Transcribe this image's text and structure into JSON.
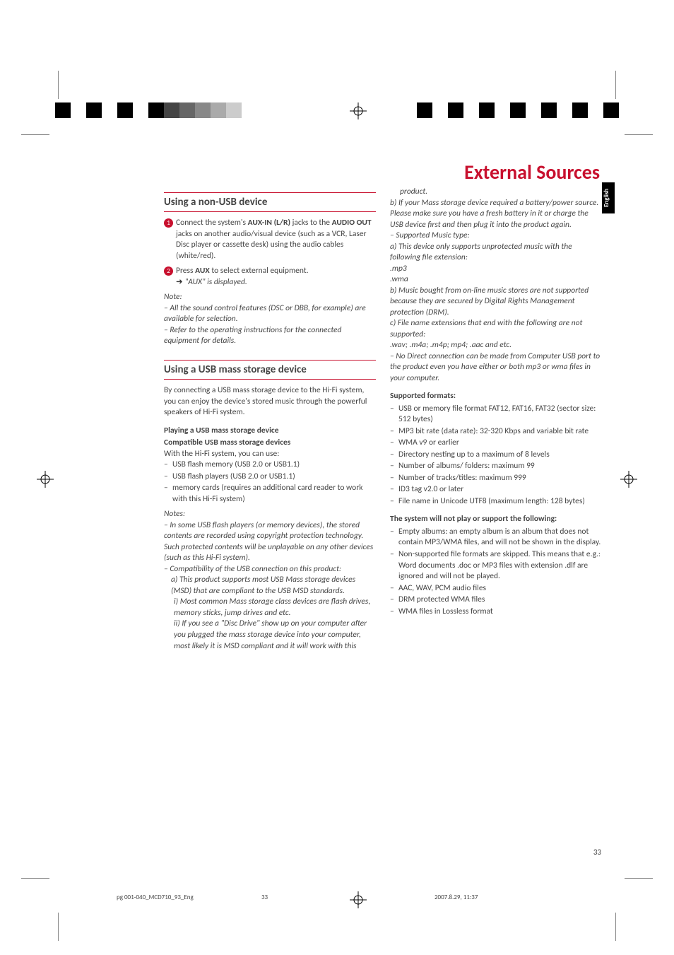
{
  "pageTitle": "External Sources",
  "langTab": "English",
  "pageNumber": "33",
  "footer": {
    "left": "pg 001-040_MCD710_93_Eng",
    "mid": "33",
    "right": "2007.8.29, 11:37"
  },
  "col1": {
    "sec1": {
      "heading": "Using a non-USB device",
      "step1": {
        "p1a": "Connect the system's ",
        "p1b": "AUX-IN (L/R)",
        "p1c": " jacks to the ",
        "p1d": "AUDIO OUT",
        "p1e": " jacks on another audio/visual device (such as a VCR, Laser Disc player or cassette desk) using the audio cables (white/red)."
      },
      "step2": {
        "p1a": "Press ",
        "p1b": "AUX",
        "p1c": " to select external equipment.",
        "arrow": "➜",
        "sub": "\"AUX\" is displayed."
      },
      "noteLabel": "Note:",
      "note1": "– All the sound control features (DSC or DBB, for example) are available for selection.",
      "note2": "– Refer to the operating instructions for the connected equipment for details."
    },
    "sec2": {
      "heading": "Using a USB mass storage device",
      "intro": "By connecting a USB mass storage device to the Hi-Fi system, you can enjoy the device's stored music through the powerful speakers of Hi-Fi system.",
      "subA": "Playing a USB mass storage device",
      "subB": "Compatible USB mass storage devices",
      "withline": "With the Hi-Fi system, you can use:",
      "bullet1": "USB flash memory (USB 2.0 or USB1.1)",
      "bullet2": "USB flash players (USB 2.0 or USB1.1)",
      "bullet3": "memory cards (requires an additional card reader to work with this Hi-Fi system)",
      "notesLabel": "Notes:",
      "n1": "– In some USB flash players (or memory devices), the stored contents are recorded using copyright protection technology. Such protected contents will be unplayable on any other devices (such as this Hi-Fi system).",
      "n2": "– Compatibility of the USB connection on this product:",
      "n2a": "a) This product supports most USB Mass storage devices (MSD) that are compliant to the USB MSD standards.",
      "n2ai": "i) Most common Mass storage class devices are flash drives, memory sticks, jump drives and etc.",
      "n2aii": "ii) If you see a \"Disc Drive\" show up on your computer after you plugged the mass storage device into your computer, most likely it is MSD compliant and it will work with this"
    }
  },
  "col2": {
    "cont": {
      "product": "product.",
      "n2b": "b) If your Mass storage device required a battery/power source. Please make sure you have a fresh battery in it or charge the USB device first and then plug it into the product again.",
      "n3": "– Supported Music type:",
      "n3a": "a) This device only supports unprotected music with the following file extension:",
      "mp3": ".mp3",
      "wma": ".wma",
      "n3b": "b) Music bought from on-line music stores are not supported because they are secured by Digital Rights Management protection (DRM).",
      "n3c": "c) File name extensions that end with the following are not supported:",
      "exts": ".wav; .m4a; .m4p; mp4; .aac and etc.",
      "n4": "– No Direct connection can be made from Computer USB port to the product even you have either or both mp3 or wma files in your computer."
    },
    "supported": {
      "heading": "Supported formats:",
      "b1": "USB or memory file format FAT12, FAT16, FAT32 (sector size: 512 bytes)",
      "b2": "MP3 bit rate (data rate): 32-320 Kbps and variable bit rate",
      "b3": "WMA v9 or earlier",
      "b4": "Directory nesting up to a maximum of 8 levels",
      "b5": "Number of albums/ folders: maximum 99",
      "b6": "Number of tracks/titles: maximum 999",
      "b7": "ID3 tag v2.0 or later",
      "b8": "File name in Unicode UTF8 (maximum length: 128 bytes)"
    },
    "notplay": {
      "heading": "The system will not play or support the following:",
      "b1": "Empty albums: an empty album is an album that does not contain MP3/WMA files, and will not be shown in the display.",
      "b2": "Non-supported file formats are skipped. This means that e.g.: Word documents .doc or MP3 files with extension .dlf are ignored and will not be played.",
      "b3": "AAC, WAV, PCM audio files",
      "b4": "DRM protected WMA files",
      "b5": "WMA files in Lossless format"
    }
  }
}
